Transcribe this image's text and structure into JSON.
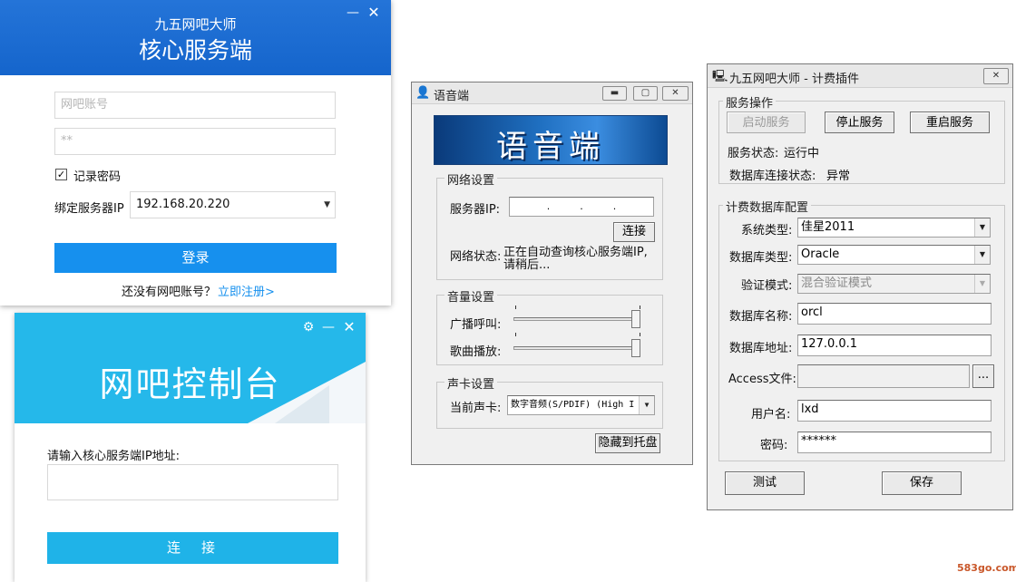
{
  "core_login": {
    "subtitle": "九五网吧大师",
    "title": "核心服务端",
    "account_placeholder": "网吧账号",
    "password_value": "**",
    "remember_label": "记录密码",
    "remember_mark": "✓",
    "server_ip_label": "绑定服务器IP",
    "server_ip_value": "192.168.20.220",
    "login_button": "登录",
    "no_account_text": "还没有网吧账号？",
    "register_link": "立即注册>",
    "minimize": "—",
    "close": "✕"
  },
  "console": {
    "title": "网吧控制台",
    "prompt": "请输入核心服务端IP地址:",
    "connect_button": "连　接",
    "settings": "⚙",
    "minimize": "—",
    "close": "✕"
  },
  "voice": {
    "window_title": "语音端",
    "banner_text": "语音端",
    "network_group": "网络设置",
    "server_ip_label": "服务器IP:",
    "ip_dots": ".　　　.　　　.",
    "connect_button": "连接",
    "status_label": "网络状态:",
    "status_value": "正在自动查询核心服务端IP,请稍后...",
    "volume_group": "音量设置",
    "broadcast_label": "广播呼叫:",
    "music_label": "歌曲播放:",
    "broadcast_level": 1.0,
    "music_level": 1.0,
    "soundcard_group": "声卡设置",
    "current_card_label": "当前声卡:",
    "current_card_value": "数字音频(S/PDIF) (High I",
    "hide_button": "隐藏到托盘"
  },
  "billing": {
    "window_title": "九五网吧大师 - 计费插件",
    "service_group": "服务操作",
    "start_button": "启动服务",
    "stop_button": "停止服务",
    "restart_button": "重启服务",
    "service_status_label": "服务状态:",
    "service_status_value": "运行中",
    "db_status_label": "数据库连接状态:",
    "db_status_value": "异常",
    "db_group": "计费数据库配置",
    "system_type_label": "系统类型:",
    "system_type_value": "佳星2011",
    "db_type_label": "数据库类型:",
    "db_type_value": "Oracle",
    "auth_label": "验证模式:",
    "auth_value": "混合验证模式",
    "db_name_label": "数据库名称:",
    "db_name_value": "orcl",
    "db_addr_label": "数据库地址:",
    "db_addr_value": "127.0.0.1",
    "access_label": "Access文件:",
    "browse_button": "...",
    "user_label": "用户名:",
    "user_value": "lxd",
    "password_label": "密码:",
    "password_value": "******",
    "test_button": "测试",
    "save_button": "保存",
    "close": "✕"
  },
  "watermark": "583go.com",
  "colors": {
    "core_blue": "#1565cc",
    "login_button": "#1690ee",
    "console_cyan": "#25b8ea",
    "link": "#1690ee"
  }
}
